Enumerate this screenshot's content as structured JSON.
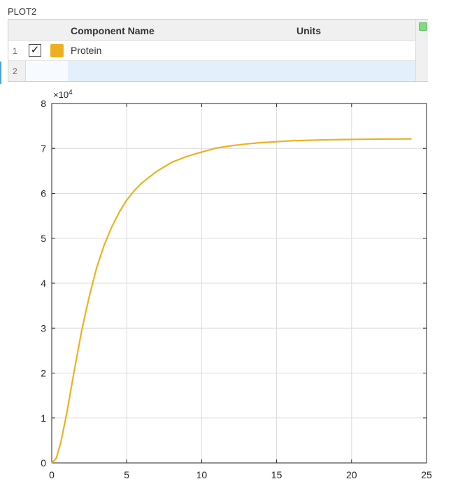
{
  "window": {
    "title": "PLOT2"
  },
  "table": {
    "headers": {
      "name": "Component Name",
      "units": "Units"
    },
    "rows": [
      {
        "num": "1",
        "checked": true,
        "check_glyph": "✓",
        "color": "#EDB120",
        "name": "Protein",
        "units": ""
      },
      {
        "num": "2",
        "checked": false,
        "name": "",
        "units": ""
      }
    ]
  },
  "chart_data": {
    "type": "line",
    "exponent_label": "×10",
    "exponent_power": "4",
    "xlim": [
      0,
      25
    ],
    "ylim": [
      0,
      80000
    ],
    "x_ticks": [
      0,
      5,
      10,
      15,
      20,
      25
    ],
    "y_ticks": [
      0,
      10000,
      20000,
      30000,
      40000,
      50000,
      60000,
      70000,
      80000
    ],
    "x_tick_labels": [
      "0",
      "5",
      "10",
      "15",
      "20",
      "25"
    ],
    "y_tick_labels": [
      "0",
      "1",
      "2",
      "3",
      "4",
      "5",
      "6",
      "7",
      "8"
    ],
    "grid": true,
    "series": [
      {
        "color": "#EDB120",
        "x": [
          0,
          0.3,
          0.6,
          1,
          1.5,
          2,
          2.5,
          3,
          3.5,
          4,
          4.5,
          5,
          5.5,
          6,
          7,
          8,
          9,
          10,
          11,
          12,
          13,
          14,
          15,
          16,
          17,
          18,
          19,
          20,
          21,
          22,
          23,
          24
        ],
        "y": [
          0,
          1000,
          4500,
          11000,
          20500,
          29500,
          37000,
          43500,
          48500,
          52500,
          55800,
          58500,
          60600,
          62300,
          64900,
          66900,
          68200,
          69200,
          70100,
          70600,
          71000,
          71300,
          71500,
          71700,
          71800,
          71900,
          71950,
          72000,
          72050,
          72080,
          72100,
          72120
        ]
      }
    ]
  }
}
